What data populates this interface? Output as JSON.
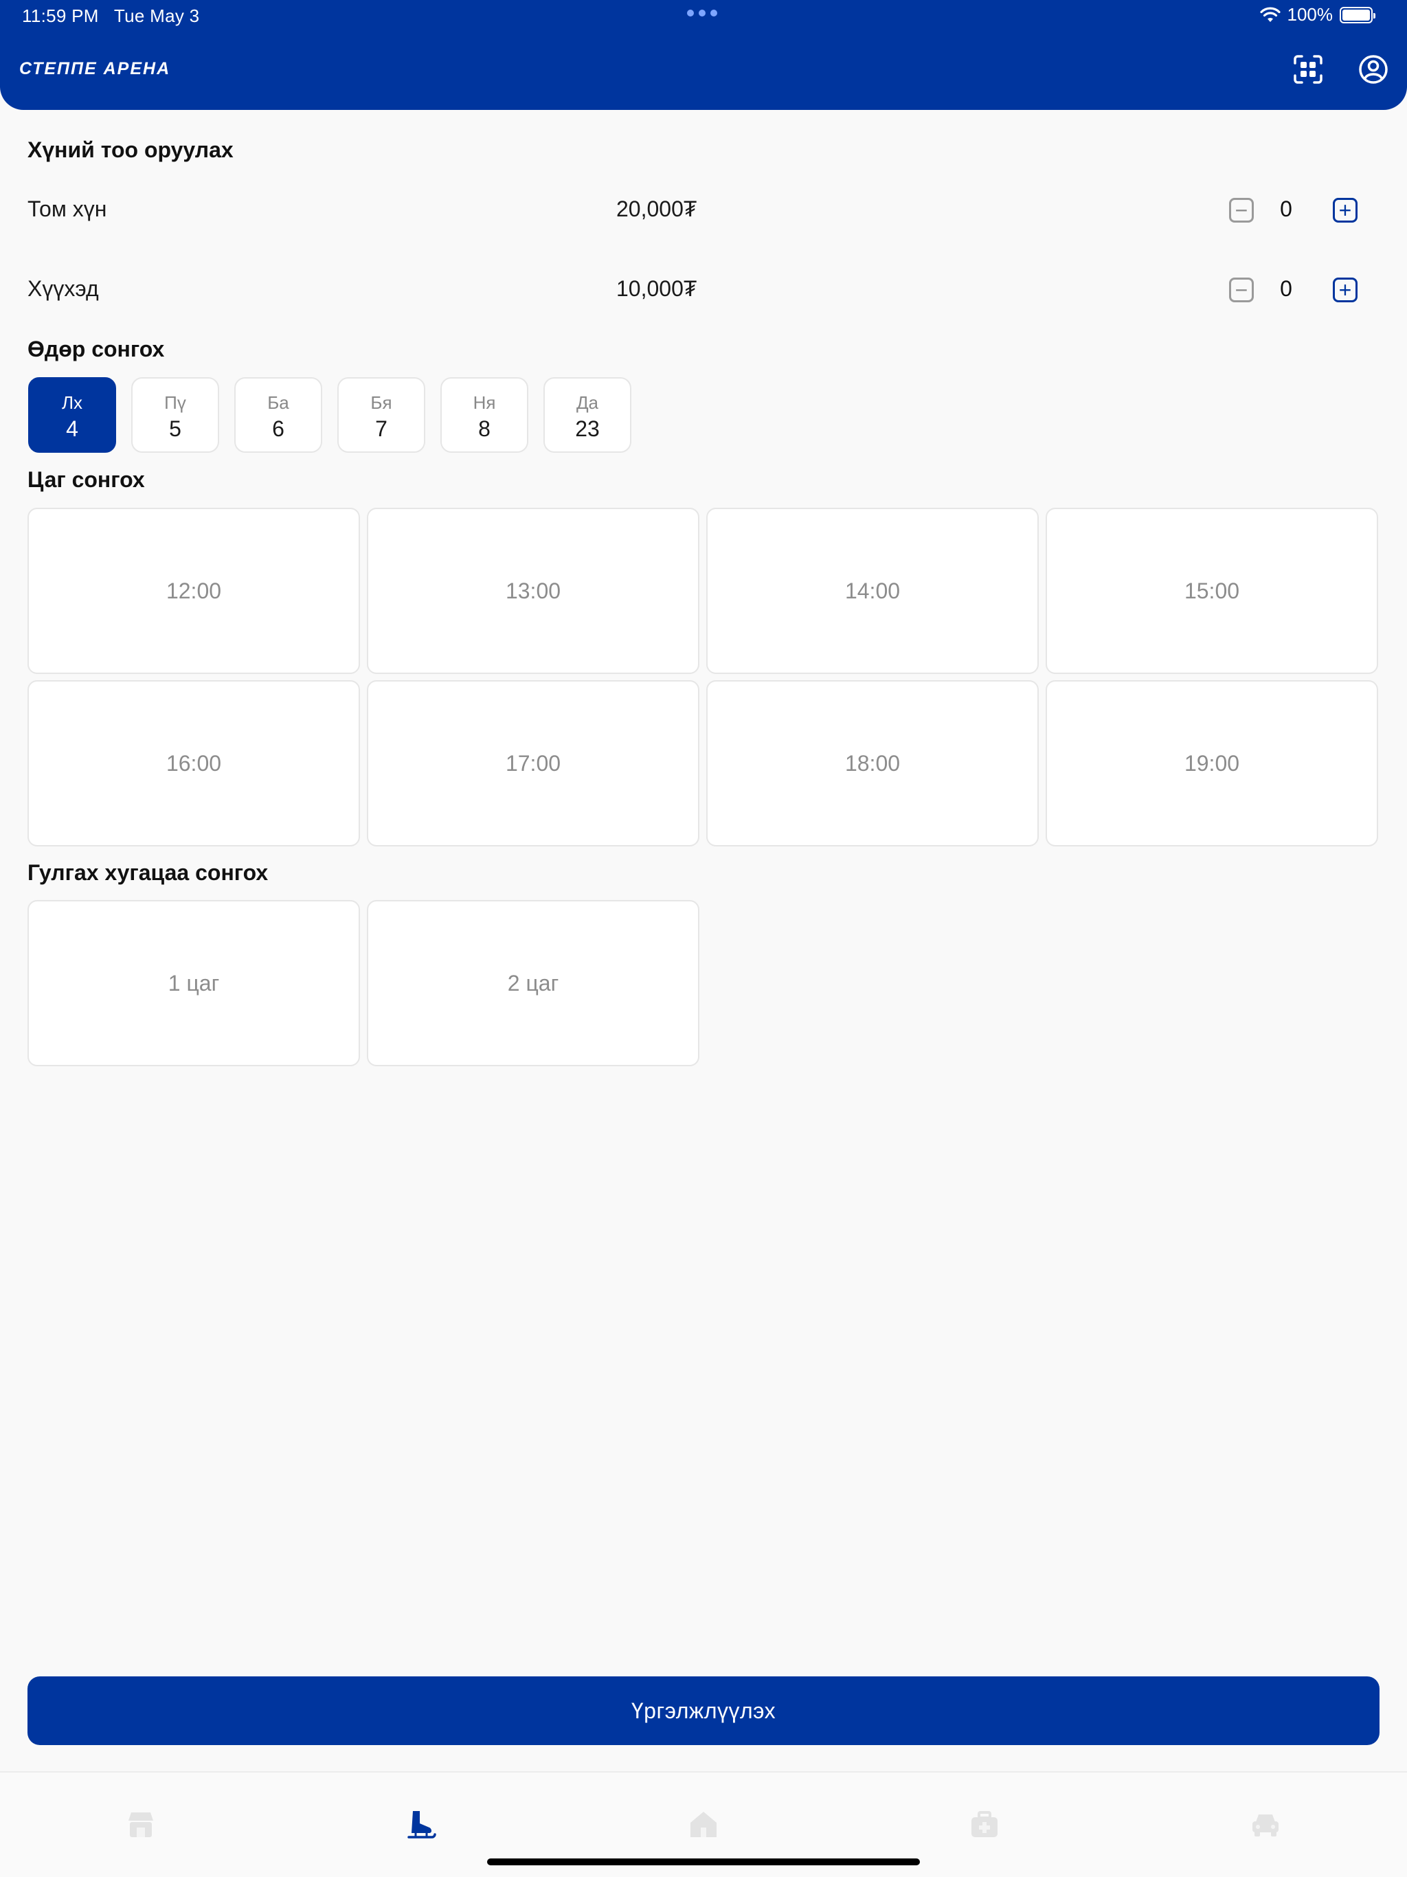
{
  "status_bar": {
    "time": "11:59 PM",
    "date": "Tue May 3",
    "battery": "100%"
  },
  "header": {
    "brand": "СТЕППЕ АРЕНА"
  },
  "passengers": {
    "title": "Хүний тоо оруулах",
    "rows": [
      {
        "label": "Том хүн",
        "price": "20,000₮",
        "count": "0"
      },
      {
        "label": "Хүүхэд",
        "price": "10,000₮",
        "count": "0"
      }
    ]
  },
  "day_section": {
    "title": "Өдөр сонгох",
    "days": [
      {
        "dow": "Лх",
        "num": "4"
      },
      {
        "dow": "Пү",
        "num": "5"
      },
      {
        "dow": "Ба",
        "num": "6"
      },
      {
        "dow": "Бя",
        "num": "7"
      },
      {
        "dow": "Ня",
        "num": "8"
      },
      {
        "dow": "Да",
        "num": "23"
      }
    ],
    "selected_index": 0
  },
  "time_section": {
    "title": "Цаг сонгох",
    "slots": [
      "12:00",
      "13:00",
      "14:00",
      "15:00",
      "16:00",
      "17:00",
      "18:00",
      "19:00"
    ]
  },
  "duration_section": {
    "title": "Гулгах хугацаа сонгох",
    "options": [
      "1 цаг",
      "2 цаг"
    ]
  },
  "continue_button": "Үргэлжлүүлэх",
  "colors": {
    "primary": "#00359e",
    "background": "#f9f9f9",
    "card_border": "#e6e6e6"
  },
  "tab_bar": {
    "items": [
      "store-icon",
      "ice-skate-icon",
      "home-icon",
      "first-aid-icon",
      "car-icon"
    ],
    "active_index": 1
  }
}
